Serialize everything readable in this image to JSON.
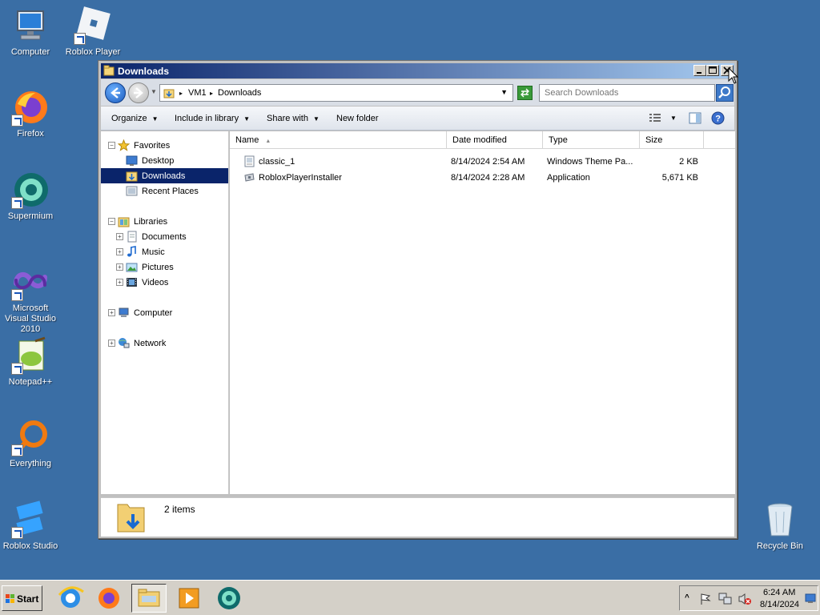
{
  "desktop": {
    "icons": [
      {
        "label": "Computer"
      },
      {
        "label": "Roblox Player"
      },
      {
        "label": "Firefox"
      },
      {
        "label": "Supermium"
      },
      {
        "label": "Microsoft Visual Studio 2010"
      },
      {
        "label": "Notepad++"
      },
      {
        "label": "Everything"
      },
      {
        "label": "Roblox Studio"
      },
      {
        "label": "Recycle Bin"
      }
    ]
  },
  "window": {
    "title": "Downloads",
    "breadcrumb": [
      "VM1",
      "Downloads"
    ],
    "search_placeholder": "Search Downloads",
    "toolbar": {
      "organize": "Organize",
      "include_in_library": "Include in library",
      "share_with": "Share with",
      "new_folder": "New folder"
    },
    "navpane": {
      "favorites": "Favorites",
      "desktop": "Desktop",
      "downloads": "Downloads",
      "recent_places": "Recent Places",
      "libraries": "Libraries",
      "documents": "Documents",
      "music": "Music",
      "pictures": "Pictures",
      "videos": "Videos",
      "computer": "Computer",
      "network": "Network"
    },
    "columns": [
      "Name",
      "Date modified",
      "Type",
      "Size"
    ],
    "files": [
      {
        "name": "classic_1",
        "date": "8/14/2024 2:54 AM",
        "type": "Windows Theme Pa...",
        "size": "2 KB"
      },
      {
        "name": "RobloxPlayerInstaller",
        "date": "8/14/2024 2:28 AM",
        "type": "Application",
        "size": "5,671 KB"
      }
    ],
    "status": "2 items"
  },
  "taskbar": {
    "start": "Start",
    "clock_time": "6:24 AM",
    "clock_date": "8/14/2024"
  },
  "colors": {
    "desktop": "#3a6ea5",
    "titlebar_start": "#0a246a",
    "titlebar_end": "#a6caf0",
    "selection": "#0a246a"
  }
}
